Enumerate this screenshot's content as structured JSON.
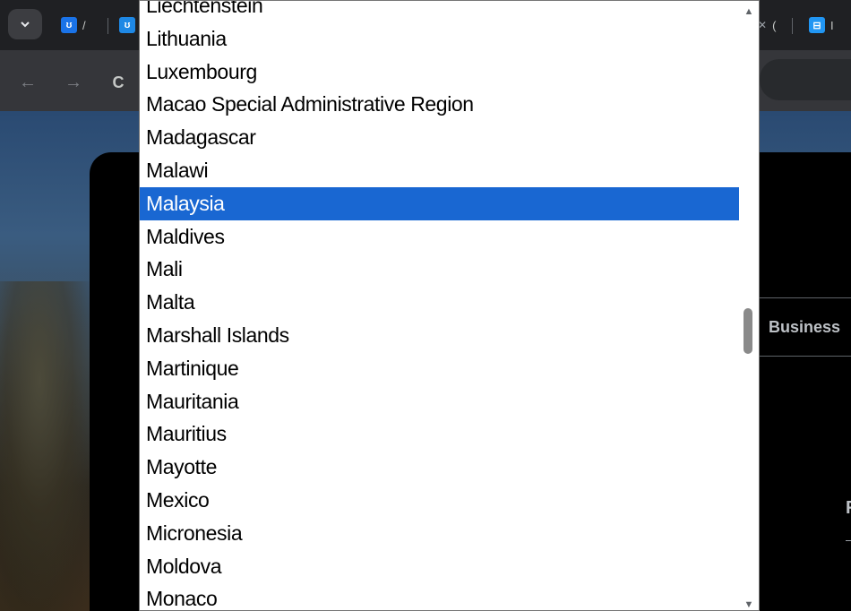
{
  "tabstrip": {
    "tab_search_icon": "chevron-down-icon",
    "tabs": [
      {
        "favicon": "ʊ",
        "label": "/"
      },
      {
        "favicon": "ʊ",
        "label": ""
      },
      {
        "favicon": "",
        "label": "("
      },
      {
        "favicon": "⊟",
        "label": "I"
      }
    ]
  },
  "toolbar": {
    "back_icon": "←",
    "forward_icon": "→",
    "reload_icon": "C"
  },
  "page": {
    "business_tab": "Business",
    "partial_text": "F"
  },
  "dropdown": {
    "selected": "Malaysia",
    "options": [
      "Liechtenstein",
      "Lithuania",
      "Luxembourg",
      "Macao Special Administrative Region",
      "Madagascar",
      "Malawi",
      "Malaysia",
      "Maldives",
      "Mali",
      "Malta",
      "Marshall Islands",
      "Martinique",
      "Mauritania",
      "Mauritius",
      "Mayotte",
      "Mexico",
      "Micronesia",
      "Moldova",
      "Monaco"
    ],
    "scroll_position_fraction": 0.5,
    "colors": {
      "selection": "#1967d2"
    }
  }
}
